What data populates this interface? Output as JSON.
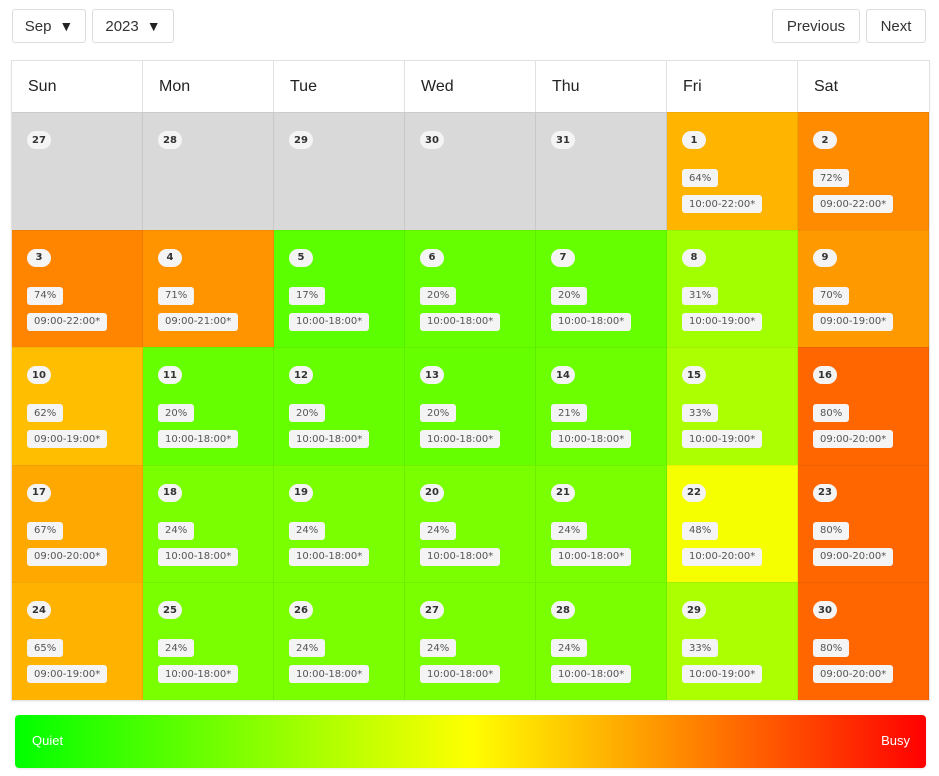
{
  "toolbar": {
    "month": "Sep",
    "year": "2023",
    "caret_icon": "▼",
    "previous_label": "Previous",
    "next_label": "Next"
  },
  "weekdays": [
    "Sun",
    "Mon",
    "Tue",
    "Wed",
    "Thu",
    "Fri",
    "Sat"
  ],
  "days": [
    {
      "day": "27",
      "other_month": true
    },
    {
      "day": "28",
      "other_month": true
    },
    {
      "day": "29",
      "other_month": true
    },
    {
      "day": "30",
      "other_month": true
    },
    {
      "day": "31",
      "other_month": true
    },
    {
      "day": "1",
      "busy": "64%",
      "hours": "10:00-22:00*",
      "color": "#ffb400"
    },
    {
      "day": "2",
      "busy": "72%",
      "hours": "09:00-22:00*",
      "color": "#ff8c00"
    },
    {
      "day": "3",
      "busy": "74%",
      "hours": "09:00-22:00*",
      "color": "#ff8400"
    },
    {
      "day": "4",
      "busy": "71%",
      "hours": "09:00-21:00*",
      "color": "#ff9400"
    },
    {
      "day": "5",
      "busy": "17%",
      "hours": "10:00-18:00*",
      "color": "#5cff00"
    },
    {
      "day": "6",
      "busy": "20%",
      "hours": "10:00-18:00*",
      "color": "#66ff00"
    },
    {
      "day": "7",
      "busy": "20%",
      "hours": "10:00-18:00*",
      "color": "#66ff00"
    },
    {
      "day": "8",
      "busy": "31%",
      "hours": "10:00-19:00*",
      "color": "#a2ff00"
    },
    {
      "day": "9",
      "busy": "70%",
      "hours": "09:00-19:00*",
      "color": "#ff9900"
    },
    {
      "day": "10",
      "busy": "62%",
      "hours": "09:00-19:00*",
      "color": "#ffbf00"
    },
    {
      "day": "11",
      "busy": "20%",
      "hours": "10:00-18:00*",
      "color": "#66ff00"
    },
    {
      "day": "12",
      "busy": "20%",
      "hours": "10:00-18:00*",
      "color": "#66ff00"
    },
    {
      "day": "13",
      "busy": "20%",
      "hours": "10:00-18:00*",
      "color": "#66ff00"
    },
    {
      "day": "14",
      "busy": "21%",
      "hours": "10:00-18:00*",
      "color": "#6bff00"
    },
    {
      "day": "15",
      "busy": "33%",
      "hours": "10:00-19:00*",
      "color": "#acff00"
    },
    {
      "day": "16",
      "busy": "80%",
      "hours": "09:00-20:00*",
      "color": "#ff6600"
    },
    {
      "day": "17",
      "busy": "67%",
      "hours": "09:00-20:00*",
      "color": "#ffa800"
    },
    {
      "day": "18",
      "busy": "24%",
      "hours": "10:00-18:00*",
      "color": "#7aff00"
    },
    {
      "day": "19",
      "busy": "24%",
      "hours": "10:00-18:00*",
      "color": "#7aff00"
    },
    {
      "day": "20",
      "busy": "24%",
      "hours": "10:00-18:00*",
      "color": "#7aff00"
    },
    {
      "day": "21",
      "busy": "24%",
      "hours": "10:00-18:00*",
      "color": "#7aff00"
    },
    {
      "day": "22",
      "busy": "48%",
      "hours": "10:00-20:00*",
      "color": "#f5ff00"
    },
    {
      "day": "23",
      "busy": "80%",
      "hours": "09:00-20:00*",
      "color": "#ff6600"
    },
    {
      "day": "24",
      "busy": "65%",
      "hours": "09:00-19:00*",
      "color": "#ffb200"
    },
    {
      "day": "25",
      "busy": "24%",
      "hours": "10:00-18:00*",
      "color": "#7aff00"
    },
    {
      "day": "26",
      "busy": "24%",
      "hours": "10:00-18:00*",
      "color": "#7aff00"
    },
    {
      "day": "27",
      "busy": "24%",
      "hours": "10:00-18:00*",
      "color": "#7aff00"
    },
    {
      "day": "28",
      "busy": "24%",
      "hours": "10:00-18:00*",
      "color": "#7aff00"
    },
    {
      "day": "29",
      "busy": "33%",
      "hours": "10:00-19:00*",
      "color": "#acff00"
    },
    {
      "day": "30",
      "busy": "80%",
      "hours": "09:00-20:00*",
      "color": "#ff6600"
    }
  ],
  "legend": {
    "low_label": "Quiet",
    "high_label": "Busy"
  }
}
